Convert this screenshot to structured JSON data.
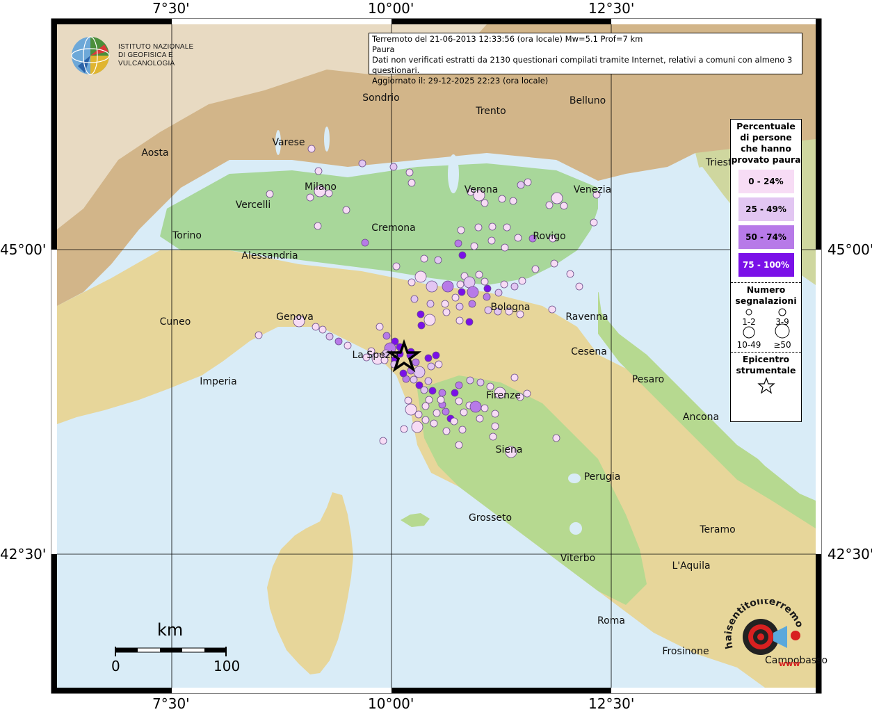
{
  "header": {
    "line1": "Terremoto del 21-06-2013 12:33:56 (ora locale) Mw=5.1 Prof=7 km",
    "line2": "Paura",
    "line3": "Dati non verificati estratti da 2130 questionari compilati tramite Internet, relativi a comuni con almeno 3 questionari.",
    "line4": "Aggiornato il: 29-12-2025 22:23 (ora locale)"
  },
  "logo": {
    "line1": "ISTITUTO NAZIONALE",
    "line2": "DI GEOFISICA E VULCANOLOGIA"
  },
  "axes": {
    "top": [
      "7°30'",
      "10°00'",
      "12°30'"
    ],
    "bottom": [
      "7°30'",
      "10°00'",
      "12°30'"
    ],
    "left": [
      "45°00'",
      "42°30'"
    ],
    "right": [
      "45°00'",
      "42°30'"
    ]
  },
  "cities": [
    {
      "name": "Sondrio"
    },
    {
      "name": "Belluno"
    },
    {
      "name": "Trento"
    },
    {
      "name": "Varese"
    },
    {
      "name": "Aosta"
    },
    {
      "name": "Milano"
    },
    {
      "name": "Verona"
    },
    {
      "name": "Venezia"
    },
    {
      "name": "Trieste"
    },
    {
      "name": "Vercelli"
    },
    {
      "name": "Cremona"
    },
    {
      "name": "Torino"
    },
    {
      "name": "Rovigo"
    },
    {
      "name": "Alessandria"
    },
    {
      "name": "Bologna"
    },
    {
      "name": "Cuneo"
    },
    {
      "name": "Genova"
    },
    {
      "name": "Ravenna"
    },
    {
      "name": "La Spezia"
    },
    {
      "name": "Cesena"
    },
    {
      "name": "Imperia"
    },
    {
      "name": "Pesaro"
    },
    {
      "name": "Firenze"
    },
    {
      "name": "Ancona"
    },
    {
      "name": "Siena"
    },
    {
      "name": "Perugia"
    },
    {
      "name": "Grosseto"
    },
    {
      "name": "Teramo"
    },
    {
      "name": "Viterbo"
    },
    {
      "name": "L'Aquila"
    },
    {
      "name": "Roma"
    },
    {
      "name": "Frosinone"
    },
    {
      "name": "Campobasso"
    }
  ],
  "legend": {
    "title": "Percentuale di persone che hanno provato paura",
    "classes": [
      {
        "label": "0 - 24%",
        "color": "#f7dcf5"
      },
      {
        "label": "25 - 49%",
        "color": "#e2c6f2"
      },
      {
        "label": "50 - 74%",
        "color": "#b77ae8"
      },
      {
        "label": "75 - 100%",
        "color": "#7a10e8"
      }
    ],
    "size_title": "Numero segnalazioni",
    "sizes": [
      "1-2",
      "3-9",
      "10-49",
      "≥50"
    ],
    "epicenter_title": "Epicentro strumentale",
    "epicenter_icon": "star-icon"
  },
  "scale": {
    "unit": "km",
    "start": "0",
    "end": "100"
  },
  "stamp": {
    "text": "haisentitoilterremoto.it",
    "sub": "www"
  },
  "colors": {
    "sea": "#d9ecf7",
    "plain": "#a8d79a",
    "hills": "#e7d69a",
    "mountain": "#d2b589",
    "high": "#f2efe8"
  }
}
